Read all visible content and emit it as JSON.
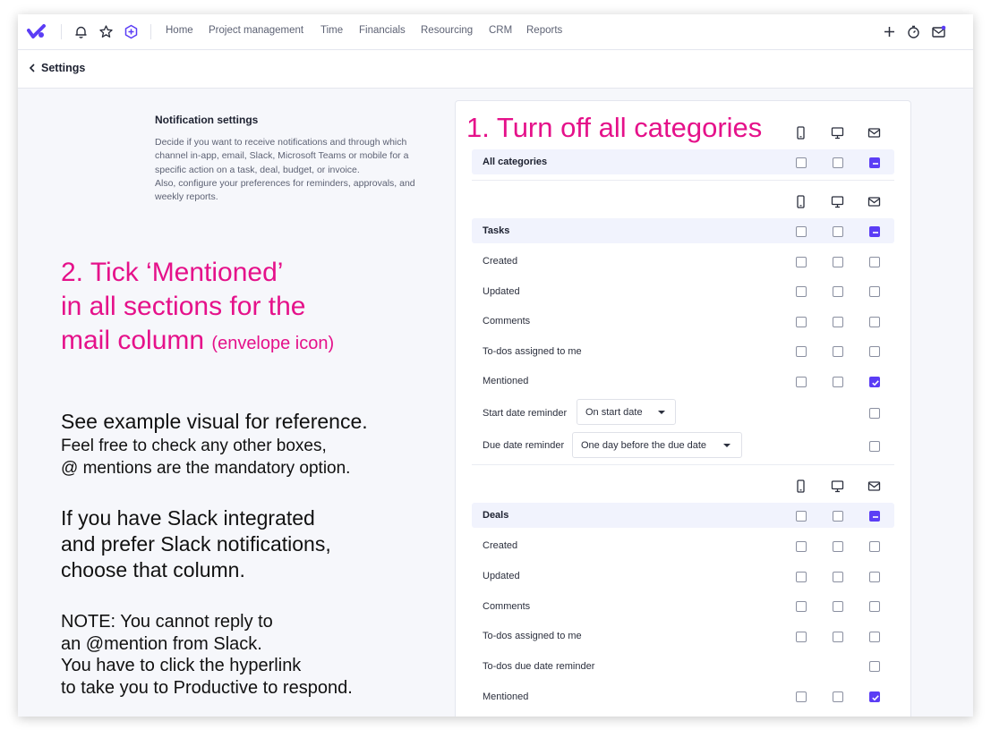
{
  "nav": {
    "items": [
      "Home",
      "Project management",
      "Time",
      "Financials",
      "Resourcing",
      "CRM",
      "Reports"
    ],
    "icons": [
      "bell-icon",
      "star-icon",
      "plus-badge-icon",
      "plus-icon",
      "timer-icon",
      "inbox-icon"
    ]
  },
  "header": {
    "title": "Settings"
  },
  "description": {
    "title": "Notification settings",
    "text": "Decide if you want to receive notifications and through which channel in-app, email, Slack, Microsoft Teams or mobile for a specific action on a task, deal, budget, or invoice.\nAlso, configure your preferences for reminders, approvals, and weekly reports."
  },
  "annotations": {
    "step1": "1. Turn off all categories",
    "step2_line1": "2. Tick ‘Mentioned’",
    "step2_line2": "in all sections for the",
    "step2_line3": "mail column",
    "step2_small": "(envelope icon)",
    "example_line1": "See example visual for reference.",
    "example_line2": "Feel free to check any other boxes,",
    "example_line3": "@ mentions are the mandatory option.",
    "slack_line1": "If you have Slack integrated",
    "slack_line2": "and prefer Slack notifications,",
    "slack_line3": "choose that column.",
    "note_line1": "NOTE: You cannot reply to",
    "note_line2": "an @mention from Slack.",
    "note_line3": "You have to click the hyperlink",
    "note_line4": "to take you to Productive to respond."
  },
  "columns": [
    "mobile-icon",
    "desktop-icon",
    "envelope-icon"
  ],
  "all_categories": {
    "label": "All categories",
    "mobile": false,
    "desktop": false,
    "email": "partial"
  },
  "tasks": {
    "header": {
      "label": "Tasks",
      "mobile": false,
      "desktop": false,
      "email": "partial"
    },
    "rows": [
      {
        "label": "Created",
        "mobile": false,
        "desktop": false,
        "email": false
      },
      {
        "label": "Updated",
        "mobile": false,
        "desktop": false,
        "email": false
      },
      {
        "label": "Comments",
        "mobile": false,
        "desktop": false,
        "email": false
      },
      {
        "label": "To-dos assigned to me",
        "mobile": false,
        "desktop": false,
        "email": false
      },
      {
        "label": "Mentioned",
        "mobile": false,
        "desktop": false,
        "email": true
      }
    ],
    "start_reminder": {
      "label": "Start date reminder",
      "value": "On start date",
      "email": false
    },
    "due_reminder": {
      "label": "Due date reminder",
      "value": "One day before the due date",
      "email": false
    }
  },
  "deals": {
    "header": {
      "label": "Deals",
      "mobile": false,
      "desktop": false,
      "email": "partial"
    },
    "rows": [
      {
        "label": "Created",
        "mobile": false,
        "desktop": false,
        "email": false
      },
      {
        "label": "Updated",
        "mobile": false,
        "desktop": false,
        "email": false
      },
      {
        "label": "Comments",
        "mobile": false,
        "desktop": false,
        "email": false
      },
      {
        "label": "To-dos assigned to me",
        "mobile": false,
        "desktop": false,
        "email": false
      },
      {
        "label": "To-dos due date reminder",
        "email": false
      },
      {
        "label": "Mentioned",
        "mobile": false,
        "desktop": false,
        "email": true
      }
    ]
  },
  "colors": {
    "accent": "#5b3df5",
    "annotation": "#e5118a"
  }
}
